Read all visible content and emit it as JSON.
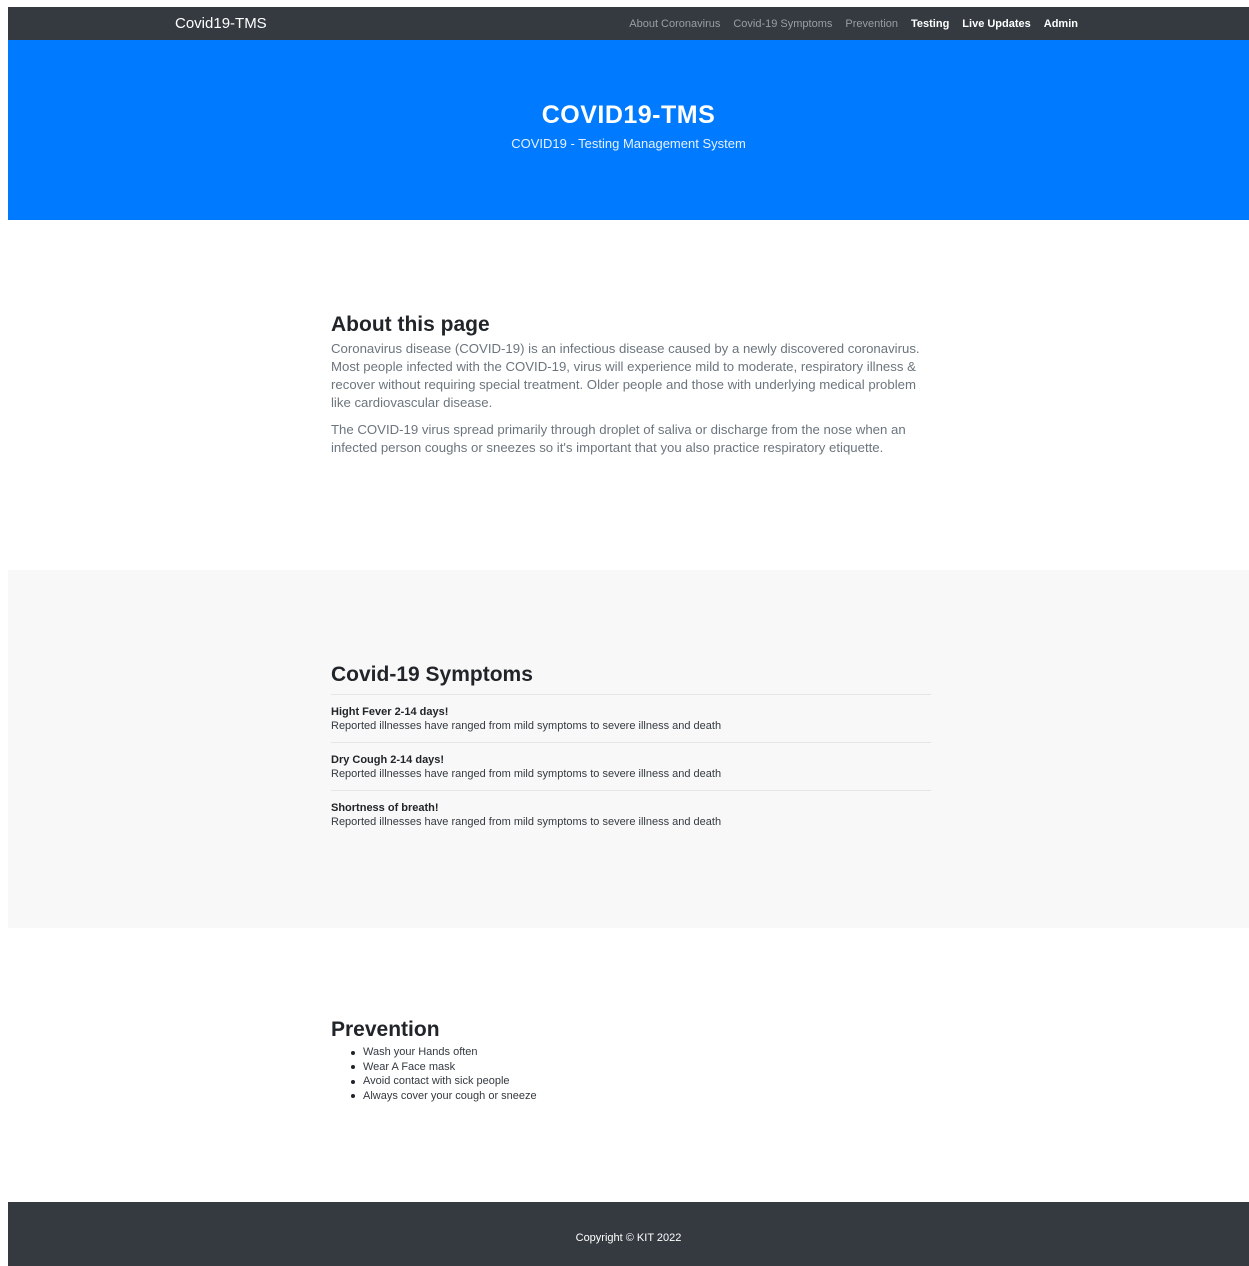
{
  "navbar": {
    "brand": "Covid19-TMS",
    "links": [
      {
        "label": "About Coronavirus"
      },
      {
        "label": "Covid-19 Symptoms"
      },
      {
        "label": "Prevention"
      },
      {
        "label": "Testing"
      },
      {
        "label": "Live Updates"
      },
      {
        "label": "Admin"
      }
    ]
  },
  "hero": {
    "title": "COVID19-TMS",
    "subtitle": "COVID19 - Testing Management System"
  },
  "about": {
    "heading": "About this page",
    "paragraphs": [
      "Coronavirus disease (COVID-19) is an infectious disease caused by a newly discovered coronavirus. Most people infected with the COVID-19, virus will experience mild to moderate, respiratory illness & recover without requiring special treatment. Older people and those with underlying medical problem like cardiovascular disease.",
      "The COVID-19 virus spread primarily through droplet of saliva or discharge from the nose when an infected person coughs or sneezes so it's important that you also practice respiratory etiquette."
    ]
  },
  "symptoms": {
    "heading": "Covid-19 Symptoms",
    "items": [
      {
        "title": "Hight Fever 2-14 days!",
        "text": "Reported illnesses have ranged from mild symptoms to severe illness and death"
      },
      {
        "title": "Dry Cough 2-14 days!",
        "text": "Reported illnesses have ranged from mild symptoms to severe illness and death"
      },
      {
        "title": "Shortness of breath!",
        "text": "Reported illnesses have ranged from mild symptoms to severe illness and death"
      }
    ]
  },
  "prevention": {
    "heading": "Prevention",
    "items": [
      "Wash your Hands often",
      "Wear A Face mask",
      "Avoid contact with sick people",
      "Always cover your cough or sneeze"
    ]
  },
  "footer": {
    "text": "Copyright © KIT 2022"
  },
  "colors": {
    "navbar_bg": "#343a40",
    "hero_bg": "#007bff",
    "symptoms_bg": "#f8f8f8",
    "footer_bg": "#343a40"
  }
}
